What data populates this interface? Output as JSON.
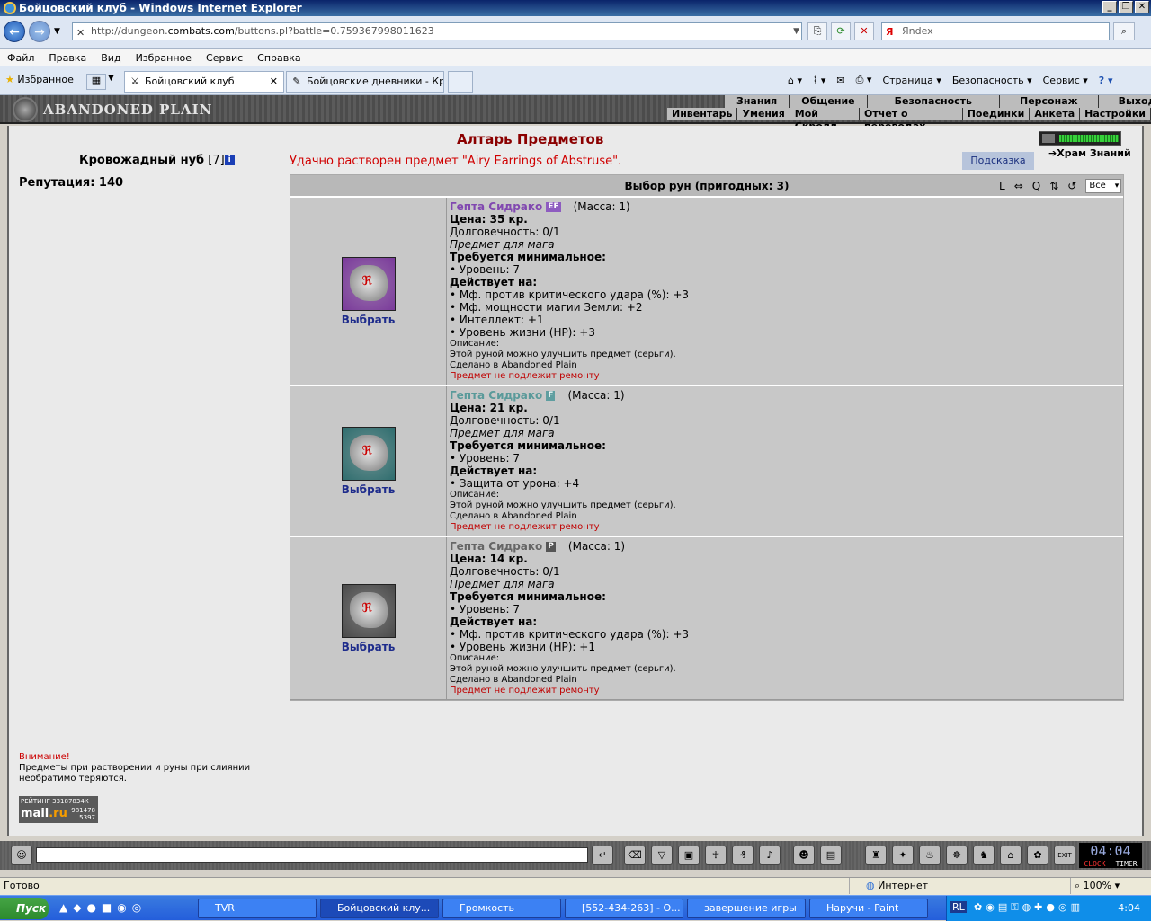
{
  "window": {
    "title": "Бойцовский клуб - Windows Internet Explorer"
  },
  "address": {
    "url_prefix": "http://dungeon.",
    "url_domain": "combats.com",
    "url_rest": "/buttons.pl?battle=0.759367998011623",
    "search_placeholder": "Яndex"
  },
  "menu": [
    "Файл",
    "Правка",
    "Вид",
    "Избранное",
    "Сервис",
    "Справка"
  ],
  "tabs": {
    "favorites": "Избранное",
    "items": [
      {
        "label": "Бойцовский клуб"
      },
      {
        "label": "Бойцовские дневники - Кр..."
      }
    ],
    "commands": [
      "Страница ▾",
      "Безопасность ▾",
      "Сервис ▾"
    ]
  },
  "game_header": {
    "logo": "ABANDONED PLAIN",
    "nav_top": [
      "Знания",
      "Общение",
      "Безопасность",
      "Персонаж",
      "Выход"
    ],
    "nav_bottom": [
      "Инвентарь",
      "Умения",
      "Мой Скролл",
      "Отчет о переводах",
      "Поединки",
      "Анкета",
      "Настройки"
    ]
  },
  "character": {
    "name": "Кровожадный нуб",
    "level": "[7]",
    "info_icon": "i",
    "reputation": "Репутация: 140"
  },
  "altar": {
    "title": "Алтарь Предметов",
    "message": "Удачно растворен предмет \"Airy Earrings of Abstruse\".",
    "hint_button": "Подсказка",
    "temple_link": "Храм Знаний",
    "gauge_fill": 1.0
  },
  "runes": {
    "header": "Выбор рун (пригодных: 3)",
    "sort_labels": [
      "L",
      "⇔",
      "Q",
      "⇅",
      "↺"
    ],
    "filter_value": "Все",
    "select_label": "Выбрать",
    "items": [
      {
        "name": "Гепта Сидрако",
        "badge": "EF",
        "badge_color": "#8e5cc0",
        "name_color": "#8148b0",
        "bg": "#7a3a9a",
        "mass": "(Масса: 1)",
        "price": "Цена: 35 кр.",
        "durability": "Долговечность: 0/1",
        "for_class": "Предмет для мага",
        "req_title": "Требуется минимальное:",
        "req": [
          "• Уровень: 7"
        ],
        "effects_title": "Действует на:",
        "effects": [
          "• Мф. против критического удара (%): +3",
          "• Мф. мощности магии Земли: +2",
          "• Интеллект: +1",
          "• Уровень жизни (HP): +3"
        ],
        "desc_title": "Описание:",
        "desc": "Этой руной можно улучшить предмет (серьги).",
        "made": "Сделано в Abandoned Plain",
        "repair": "Предмет не подлежит ремонту"
      },
      {
        "name": "Гепта Сидрако",
        "badge": "F",
        "badge_color": "#5f9ea0",
        "name_color": "#5a9a9a",
        "bg": "#2f6d6e",
        "mass": "(Масса: 1)",
        "price": "Цена: 21 кр.",
        "durability": "Долговечность: 0/1",
        "for_class": "Предмет для мага",
        "req_title": "Требуется минимальное:",
        "req": [
          "• Уровень: 7"
        ],
        "effects_title": "Действует на:",
        "effects": [
          "• Защита от урона: +4"
        ],
        "desc_title": "Описание:",
        "desc": "Этой руной можно улучшить предмет (серьги).",
        "made": "Сделано в Abandoned Plain",
        "repair": "Предмет не подлежит ремонту"
      },
      {
        "name": "Гепта Сидрако",
        "badge": "P",
        "badge_color": "#555555",
        "name_color": "#666666",
        "bg": "#4a4a4a",
        "mass": "(Масса: 1)",
        "price": "Цена: 14 кр.",
        "durability": "Долговечность: 0/1",
        "for_class": "Предмет для мага",
        "req_title": "Требуется минимальное:",
        "req": [
          "• Уровень: 7"
        ],
        "effects_title": "Действует на:",
        "effects": [
          "• Мф. против критического удара (%): +3",
          "• Уровень жизни (HP): +1"
        ],
        "desc_title": "Описание:",
        "desc": "Этой руной можно улучшить предмет (серьги).",
        "made": "Сделано в Abandoned Plain",
        "repair": "Предмет не подлежит ремонту"
      }
    ]
  },
  "warning": {
    "title": "Внимание!",
    "line1": "Предметы при растворении и руны при слиянии",
    "line2": "необратимо теряются."
  },
  "mailru": {
    "label": "РЕЙТИНГ 33187834К",
    "brand_a": "mail",
    "brand_b": ".ru",
    "n1": "981478",
    "n2": "5397"
  },
  "clock": {
    "time": "04:04",
    "label1": "CLOCK",
    "label2": "TIMER"
  },
  "status": {
    "text": "Готово",
    "zone": "Интернет",
    "zoom": "100%"
  },
  "taskbar": {
    "start": "Пуск",
    "items": [
      "TVR",
      "Бойцовский клу...",
      "Громкость",
      "[552-434-263] - О...",
      "завершение игры",
      "Наручи - Paint"
    ],
    "lang": "RL",
    "time": "4:04"
  }
}
